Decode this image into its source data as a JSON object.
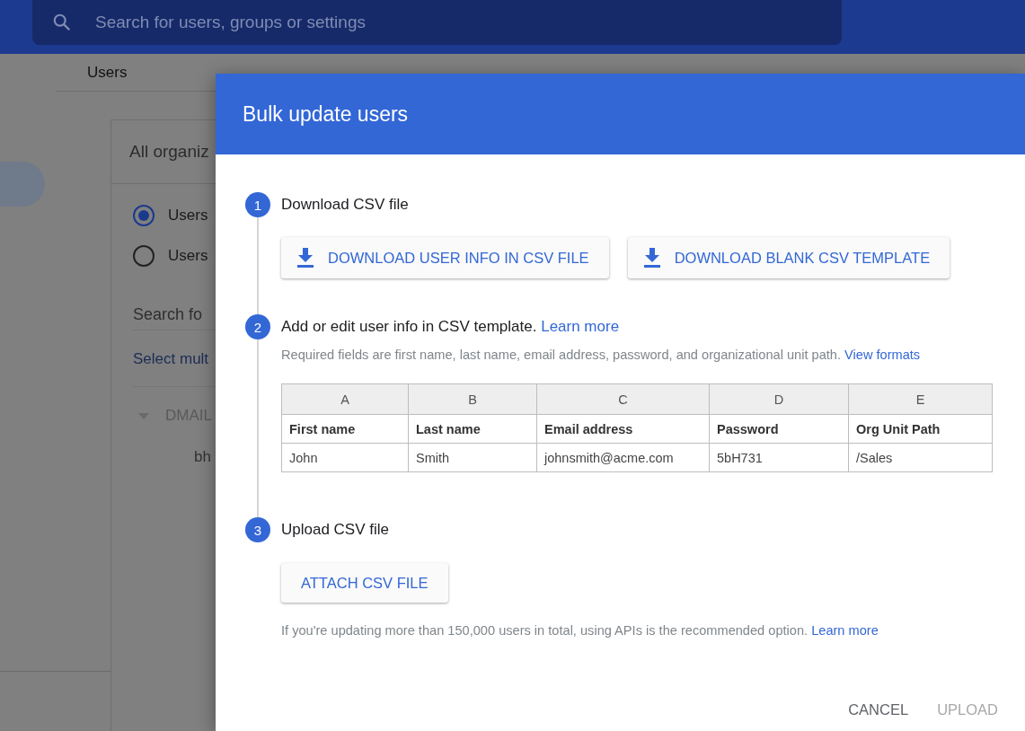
{
  "search": {
    "placeholder": "Search for users, groups or settings"
  },
  "breadcrumb": "Users",
  "org_panel": {
    "title": "All organiz",
    "options": [
      {
        "label": "Users",
        "selected": true
      },
      {
        "label": "Users",
        "selected": false
      }
    ],
    "search": {
      "placeholder": "Search fo"
    },
    "link": "Select mult",
    "tree": [
      {
        "label": "DMAIL",
        "expanded": true,
        "children": [
          {
            "label": "bh"
          }
        ]
      }
    ]
  },
  "dialog": {
    "title": "Bulk update users",
    "steps": [
      {
        "kind": "buttons",
        "number": "1",
        "title": "Download CSV file",
        "buttons": [
          "DOWNLOAD USER INFO IN CSV FILE",
          "DOWNLOAD BLANK CSV TEMPLATE"
        ]
      },
      {
        "kind": "table",
        "number": "2",
        "title": "Add or edit user info in CSV template.",
        "title_link": "Learn more",
        "description": "Required fields are first name, last name, email address, password, and organizational unit path.",
        "description_link": "View formats",
        "table": {
          "columns": [
            "A",
            "B",
            "C",
            "D",
            "E"
          ],
          "header": [
            "First name",
            "Last name",
            "Email address",
            "Password",
            "Org Unit Path"
          ],
          "rows": [
            [
              "John",
              "Smith",
              "johnsmith@acme.com",
              "5bH731",
              "/Sales"
            ]
          ]
        }
      },
      {
        "kind": "upload",
        "number": "3",
        "title": "Upload CSV file",
        "button": "ATTACH CSV FILE",
        "note": "If you're updating more than 150,000 users in total, using APIs is the recommended option.",
        "note_link": "Learn more"
      }
    ],
    "actions": [
      {
        "label": "CANCEL",
        "disabled": false
      },
      {
        "label": "UPLOAD",
        "disabled": true
      }
    ]
  }
}
